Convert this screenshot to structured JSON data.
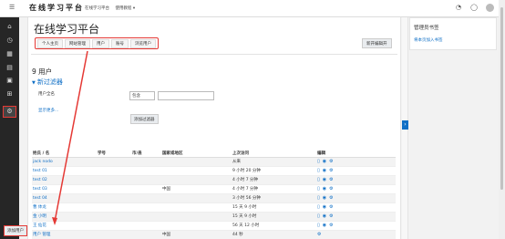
{
  "app": {
    "brand": "在线学习平台"
  },
  "topnav": {
    "items": [
      "在线学习平台",
      "使用教程 ▾"
    ]
  },
  "sidebar": {
    "items": [
      "home-icon",
      "dashboard-icon",
      "calendar-icon",
      "files-icon",
      "course-icon",
      "content-icon",
      "site-admin-icon"
    ]
  },
  "page": {
    "title": "在线学习平台"
  },
  "tabs": [
    "个人主页",
    "网站管理",
    "用户",
    "账号",
    "浏览用户"
  ],
  "buttons": {
    "edit_block": "新开编辑开",
    "add_filter": "添加过滤器",
    "add_user": "添加用户"
  },
  "users": {
    "count_title": "9 用户",
    "filter_title": "新过滤器",
    "filter_label": "用户全名",
    "filter_select": "包含",
    "filter_input": "",
    "show_more": "显示更多..."
  },
  "table": {
    "headers": [
      "姓氏 / 名",
      "学号",
      "市/县",
      "国家或地区",
      "上次访问",
      "编辑"
    ],
    "rows": [
      {
        "name": "jack nodo",
        "country": "",
        "last": "从来",
        "icons": true
      },
      {
        "name": "test 01",
        "country": "",
        "last": "9 小时 20 分钟",
        "icons": true
      },
      {
        "name": "test 02",
        "country": "",
        "last": "4 小时 7 分钟",
        "icons": true
      },
      {
        "name": "test 03",
        "country": "中国",
        "last": "4 小时 7 分钟",
        "icons": true
      },
      {
        "name": "test 04",
        "country": "",
        "last": "3 小时 56 分钟",
        "icons": true
      },
      {
        "name": "曹 体龙",
        "country": "",
        "last": "15 天 9 小时",
        "icons": true
      },
      {
        "name": "金 小明",
        "country": "",
        "last": "15 天 9 小时",
        "icons": true
      },
      {
        "name": "王 仙花",
        "country": "",
        "last": "56 天 12 小时",
        "icons": true
      },
      {
        "name": "用户 管理",
        "country": "中国",
        "last": "44 秒",
        "icons": false
      }
    ]
  },
  "block": {
    "title": "管理员书签",
    "link": "将本页加入书签"
  },
  "colors": {
    "accent": "#0f6fc6",
    "highlight": "#e53935",
    "sidebar": "#262626"
  }
}
